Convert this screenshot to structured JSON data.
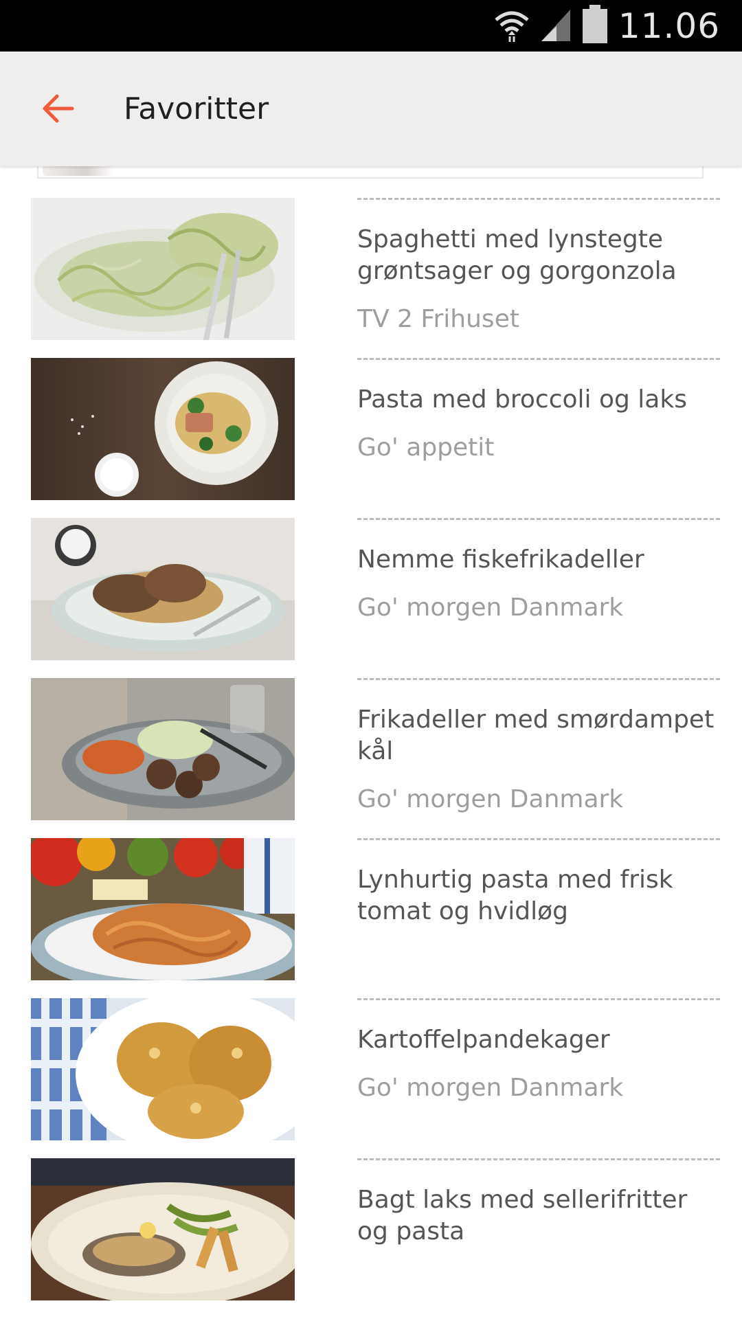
{
  "status_bar": {
    "time": "11.06",
    "icons": [
      "wifi-icon",
      "signal-icon",
      "battery-icon"
    ]
  },
  "app_bar": {
    "back_icon": "arrow-left-icon",
    "title": "Favoritter",
    "accent_color": "#ef5a3c"
  },
  "recipes": [
    {
      "title": "Spaghetti med lynstegte grøntsager og gorgonzola",
      "source": "TV 2 Frihuset"
    },
    {
      "title": "Pasta med broccoli og laks",
      "source": "Go' appetit"
    },
    {
      "title": "Nemme fiskefrikadeller",
      "source": "Go' morgen Danmark"
    },
    {
      "title": "Frikadeller med smørdampet kål",
      "source": "Go' morgen Danmark"
    },
    {
      "title": "Lynhurtig pasta med frisk tomat og hvidløg",
      "source": ""
    },
    {
      "title": "Kartoffelpandekager",
      "source": "Go' morgen Danmark"
    },
    {
      "title": "Bagt laks med sellerifritter og pasta",
      "source": ""
    }
  ]
}
